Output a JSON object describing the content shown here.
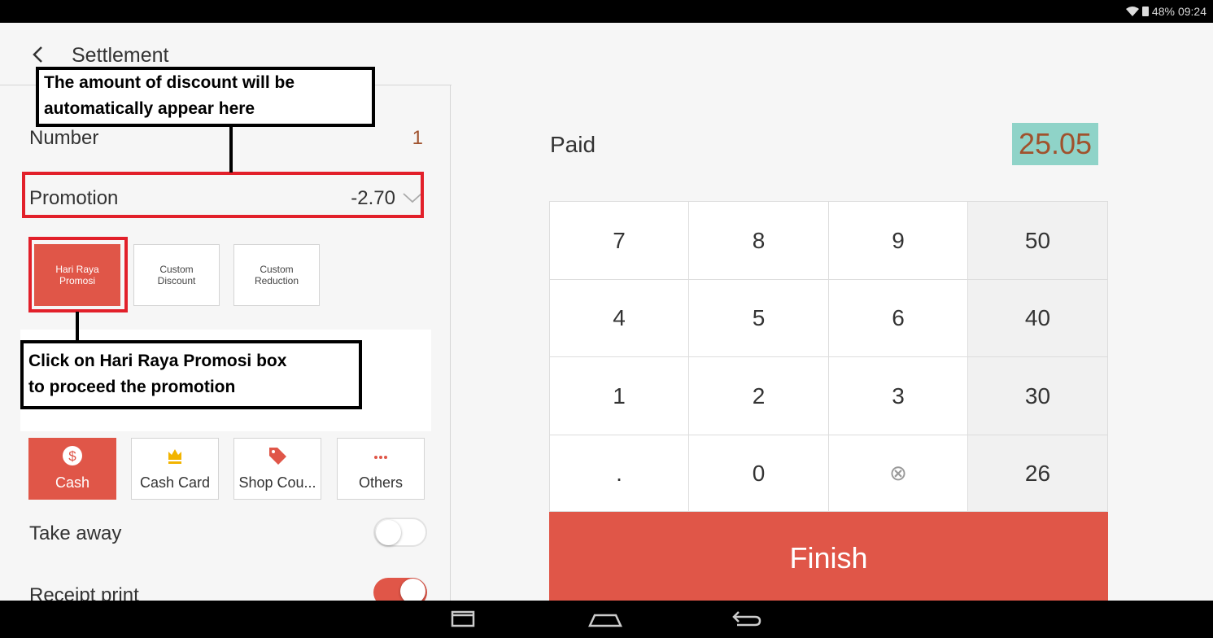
{
  "status_bar": {
    "battery": "48%",
    "time": "09:24"
  },
  "header": {
    "title": "Settlement"
  },
  "left": {
    "number_label": "Number",
    "number_value": "1",
    "promotion_label": "Promotion",
    "promotion_value": "-2.70",
    "promo_buttons": [
      "Hari Raya Promosi",
      "Custom Discount",
      "Custom Reduction"
    ],
    "payment_methods": [
      {
        "label": "Cash",
        "icon": "dollar-icon"
      },
      {
        "label": "Cash Card",
        "icon": "crown-icon"
      },
      {
        "label": "Shop Cou...",
        "icon": "tag-icon"
      },
      {
        "label": "Others",
        "icon": "more-icon"
      }
    ],
    "take_away_label": "Take away",
    "take_away_on": false,
    "receipt_print_label": "Receipt print",
    "receipt_print_on": true
  },
  "right": {
    "paid_label": "Paid",
    "paid_value": "25.05",
    "keys": [
      [
        "7",
        "8",
        "9",
        "50"
      ],
      [
        "4",
        "5",
        "6",
        "40"
      ],
      [
        "1",
        "2",
        "3",
        "30"
      ],
      [
        ".",
        "0",
        "⊗",
        "26"
      ]
    ],
    "finish_label": "Finish"
  },
  "annotations": {
    "top_line1": "The amount of discount will be",
    "top_line2": "automatically appear here",
    "bottom_line1": "Click on Hari Raya Promosi box",
    "bottom_line2": "to proceed the promotion"
  },
  "colors": {
    "accent": "#e05648",
    "highlight": "#8fd3c8",
    "value": "#a0522d"
  }
}
